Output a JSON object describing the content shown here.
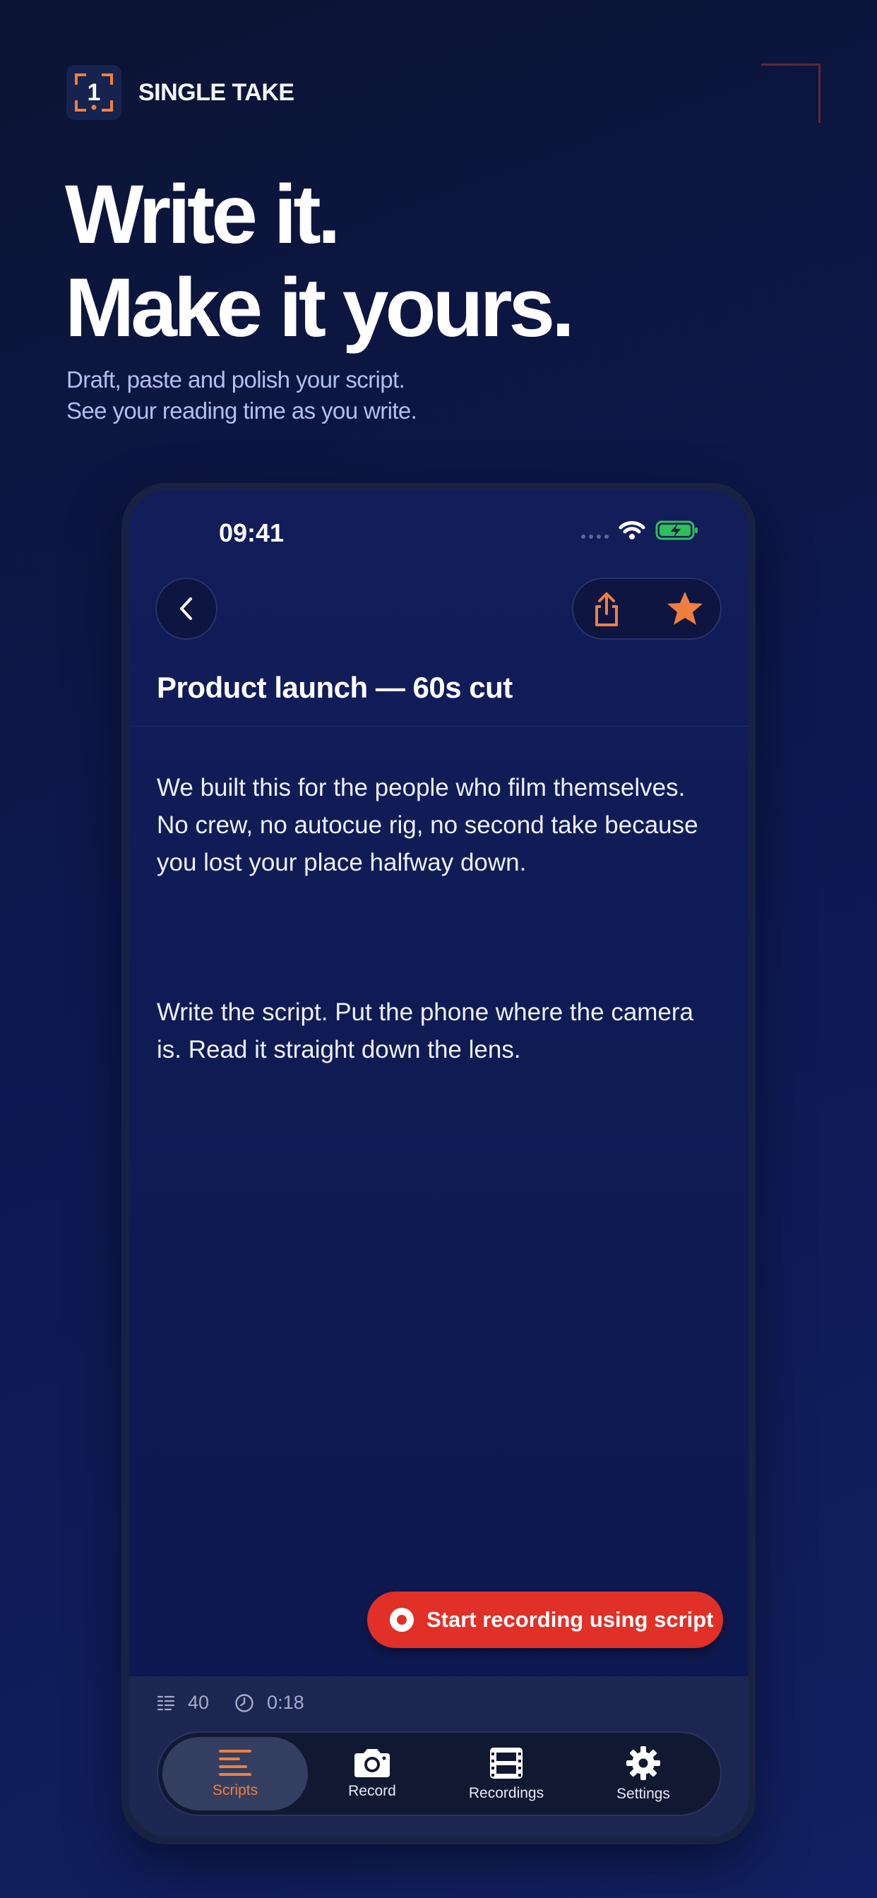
{
  "brand": {
    "name": "SINGLE TAKE",
    "logo_digit": "1"
  },
  "headline": {
    "line1": "Write it.",
    "line2": "Make it yours."
  },
  "subtext": {
    "line1": "Draft, paste and polish your script.",
    "line2": "See your reading time as you write."
  },
  "status_bar": {
    "time": "09:41"
  },
  "editor": {
    "title": "Product launch — 60s cut",
    "paragraph1_lines": [
      "We built this for the people who film themselves.",
      "No crew, no autocue rig, no second take because",
      "you lost your place halfway down."
    ],
    "paragraph2_lines": [
      "Write the script. Put the phone where the camera",
      "is. Read it straight down the lens."
    ]
  },
  "record_button": {
    "label": "Start recording using script"
  },
  "stats": {
    "word_count": "40",
    "read_time": "0:18"
  },
  "tabs": [
    {
      "label": "Scripts",
      "icon": "lines-icon",
      "active": true
    },
    {
      "label": "Record",
      "icon": "camera-icon",
      "active": false
    },
    {
      "label": "Recordings",
      "icon": "film-icon",
      "active": false
    },
    {
      "label": "Settings",
      "icon": "gear-icon",
      "active": false
    }
  ],
  "colors": {
    "accent_orange": "#f07f3f",
    "record_red": "#e03028",
    "battery_green": "#2fbf5a"
  }
}
